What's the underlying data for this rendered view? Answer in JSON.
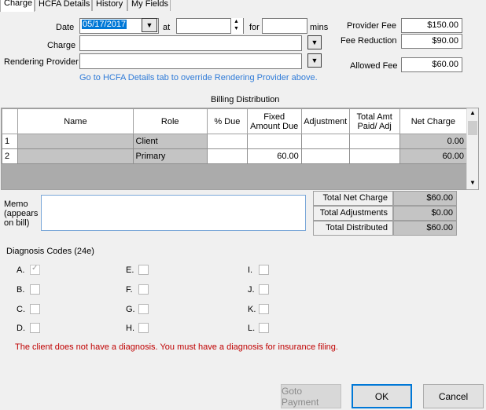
{
  "tabs": [
    "Charge",
    "HCFA Details",
    "History",
    "My Fields"
  ],
  "form": {
    "date_label": "Date",
    "date_value": "05/17/2017",
    "at_label": "at",
    "for_label": "for",
    "mins_label": "mins",
    "charge_label": "Charge",
    "rendering_provider_label": "Rendering Provider",
    "hcfa_link": "Go to HCFA Details tab to override Rendering Provider above."
  },
  "fees": {
    "provider_fee_label": "Provider Fee",
    "provider_fee": "$150.00",
    "fee_reduction_label": "Fee Reduction",
    "fee_reduction": "$90.00",
    "allowed_fee_label": "Allowed Fee",
    "allowed_fee": "$60.00"
  },
  "billing": {
    "title": "Billing Distribution",
    "headers": {
      "name": "Name",
      "role": "Role",
      "pct": "% Due",
      "fixed": "Fixed Amount Due",
      "adj": "Adjustment",
      "paid": "Total Amt Paid/ Adj",
      "net": "Net Charge"
    },
    "rows": [
      {
        "num": "1",
        "name": "",
        "role": "Client",
        "pct": "",
        "fixed": "",
        "adj": "",
        "paid": "",
        "net": "0.00"
      },
      {
        "num": "2",
        "name": "",
        "role": "Primary",
        "pct": "",
        "fixed": "60.00",
        "adj": "",
        "paid": "",
        "net": "60.00"
      }
    ]
  },
  "memo_label": "Memo (appears on bill)",
  "totals": {
    "net_label": "Total Net Charge",
    "net_value": "$60.00",
    "adj_label": "Total Adjustments",
    "adj_value": "$0.00",
    "dist_label": "Total Distributed",
    "dist_value": "$60.00"
  },
  "diagnosis": {
    "title": "Diagnosis Codes (24e)",
    "codes": [
      "A.",
      "B.",
      "C.",
      "D.",
      "E.",
      "F.",
      "G.",
      "H.",
      "I.",
      "J.",
      "K.",
      "L."
    ],
    "checked": "A.",
    "error": "The client does not have a diagnosis. You must have a diagnosis for insurance filing."
  },
  "buttons": {
    "goto_payment": "Goto Payment",
    "ok": "OK",
    "cancel": "Cancel"
  },
  "icons": {
    "dropdown": "chevron-down-icon",
    "spinner": "spin-updown-icon",
    "scroll_up": "chevron-up-icon",
    "scroll_down": "chevron-down-icon",
    "check": "checkmark-icon"
  },
  "colors": {
    "link": "#2f7bd8",
    "error": "#c00000",
    "default_button_border": "#0078d7"
  }
}
